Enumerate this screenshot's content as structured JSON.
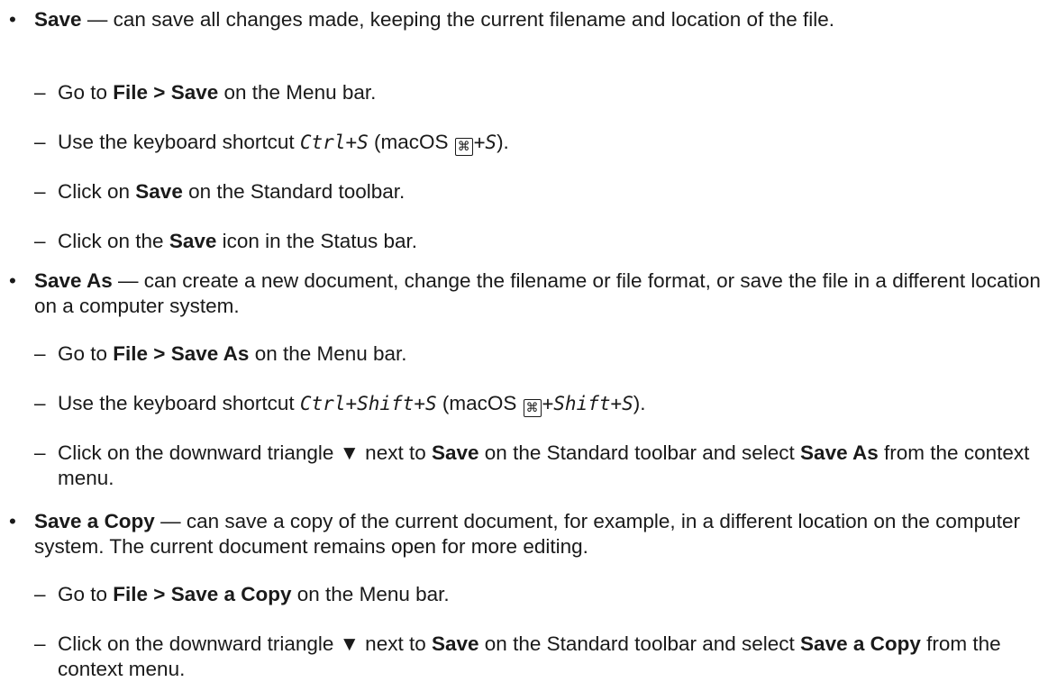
{
  "sections": [
    {
      "title": "Save",
      "description": " — can save all changes made, keeping the current filename and location of the file.",
      "steps": [
        {
          "pre": "Go to ",
          "bold": "File > Save",
          "post": " on the Menu bar."
        },
        {
          "pre": "Use the keyboard shortcut ",
          "shortcut": "Ctrl+S",
          "mac_pre": " (macOS ",
          "mac_key": "⌘",
          "mac_shortcut": "+S",
          "mac_post": ")."
        },
        {
          "pre": "Click on ",
          "bold": "Save",
          "post": " on the Standard toolbar."
        },
        {
          "pre": "Click on the ",
          "bold": "Save",
          "post": " icon in the Status bar."
        }
      ]
    },
    {
      "title": "Save As",
      "description": " — can create a new document, change the filename or file format, or save the file in a different location on a computer system.",
      "steps": [
        {
          "pre": "Go to ",
          "bold": "File > Save As",
          "post": " on the Menu bar."
        },
        {
          "pre": "Use the keyboard shortcut ",
          "shortcut": "Ctrl+Shift+S",
          "mac_pre": " (macOS ",
          "mac_key": "⌘",
          "mac_shortcut": "+Shift+S",
          "mac_post": ")."
        },
        {
          "pre": "Click on the downward triangle ▼ next to ",
          "bold": "Save",
          "mid": " on the Standard toolbar and select ",
          "bold2": "Save As",
          "post": " from the context menu."
        }
      ]
    },
    {
      "title": "Save a Copy",
      "description": " — can save a copy of the current document, for example, in a different location on the computer system. The current document remains open for more editing.",
      "steps": [
        {
          "pre": "Go to ",
          "bold": "File > Save a Copy",
          "post": " on the Menu bar."
        },
        {
          "pre": "Click on the downward triangle ▼ next to ",
          "bold": "Save",
          "mid": " on the Standard toolbar and select ",
          "bold2": "Save a Copy",
          "post": " from the context menu."
        }
      ]
    }
  ],
  "symbols": {
    "bullet": "•",
    "dash": "–"
  }
}
